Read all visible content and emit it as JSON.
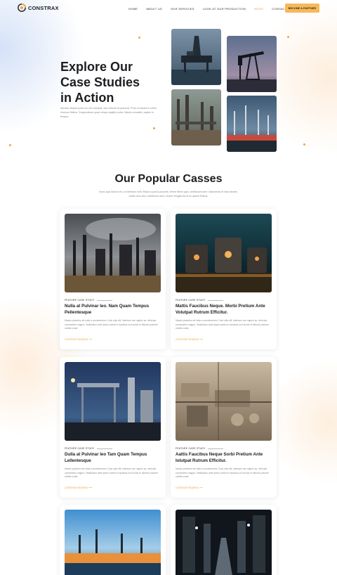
{
  "brand": {
    "name": "CONSTRAX"
  },
  "nav": {
    "items": [
      {
        "label": "HOME",
        "active": false
      },
      {
        "label": "ABOUT US",
        "active": false
      },
      {
        "label": "OUR SERVICES",
        "active": false
      },
      {
        "label": "LOOK AT OUR PRODUCTION",
        "active": false
      },
      {
        "label": "NEWS",
        "active": true
      },
      {
        "label": "CONTACT",
        "active": false
      }
    ],
    "cta": "BECOME A PARTNER"
  },
  "hero": {
    "title_line1": "Explore Our",
    "title_line2": "Case Studies",
    "title_line3": "in Action",
    "description": "Aenean aliquet purus eu orci volutpat, sed ultrices mi placerat. Proin a mauris in lorem rhoncus finibus. Suspendisse quam neque sagittis porta. Mauris convallis, sapien in tempor."
  },
  "cases": {
    "title": "Our Popular Casses",
    "description": "Nunc quis dictum leo, in interdum velit. Etiam a purus posuere, ferme libero quis, vestibulum sem. Maecenas et erat lobortis, mollis arcu sed, vestibulum sem. Donec feugiat dui id ex aptent finibus.",
    "cards": [
      {
        "tag": "FEATURE CASE STUDY",
        "title": "Nulla at Pulvinar leo. Nam Quam Tempus Pellentesque",
        "description": "Mauris pharetra vel nulla a condimentum. Duis odio elit, interdum nec sapien ac, vehicula consectetur magna. Vestibulum ante ipsum primis in faucibus orci luctus et ultrices posuere cubilia curae.",
        "link": "CONTINUE READING"
      },
      {
        "tag": "FEATURE CASE STUDY",
        "title": "Mattis Faucibus Neque. Morbi Pretium Ante Volutpat Rutrum Efficitur.",
        "description": "Mauris pharetra vel nulla a condimentum. Duis odio elit, interdum nec sapien ac, vehicula consectetur magna. Vestibulum ante ipsum primis in faucibus orci luctus et ultrices posuere cubilia curae.",
        "link": "CONTINUE READING"
      },
      {
        "tag": "FEATURE CASE STUDY",
        "title": "Dulla at Pulvinar leo Tam Quam Tempus Lellentesque",
        "description": "Mauris pharetra vel nulla a condimentum. Duis odio elit, interdum nec sapien ac, vehicula consectetur magna. Vestibulum ante ipsum primis in faucibus orci luctus et ultrices posuere cubilia curae.",
        "link": "CONTINUE READING"
      },
      {
        "tag": "FEATURE CASE STUDY",
        "title": "Aattis Faucibus Neque Sorbi Pretium Ante Iolutpat Rutrum Efficitur.",
        "description": "Mauris pharetra vel nulla a condimentum. Duis odio elit, interdum nec sapien ac, vehicula consectetur magna. Vestibulum ante ipsum primis in faucibus orci luctus et ultrices posuere cubilia curae.",
        "link": "CONTINUE READING"
      }
    ]
  },
  "colors": {
    "accent": "#f0a240",
    "cta": "#f7b85a",
    "heading": "#1d1d22",
    "muted": "#8a8a90"
  },
  "icons": [
    "logo-icon",
    "arrow-right-icon"
  ]
}
